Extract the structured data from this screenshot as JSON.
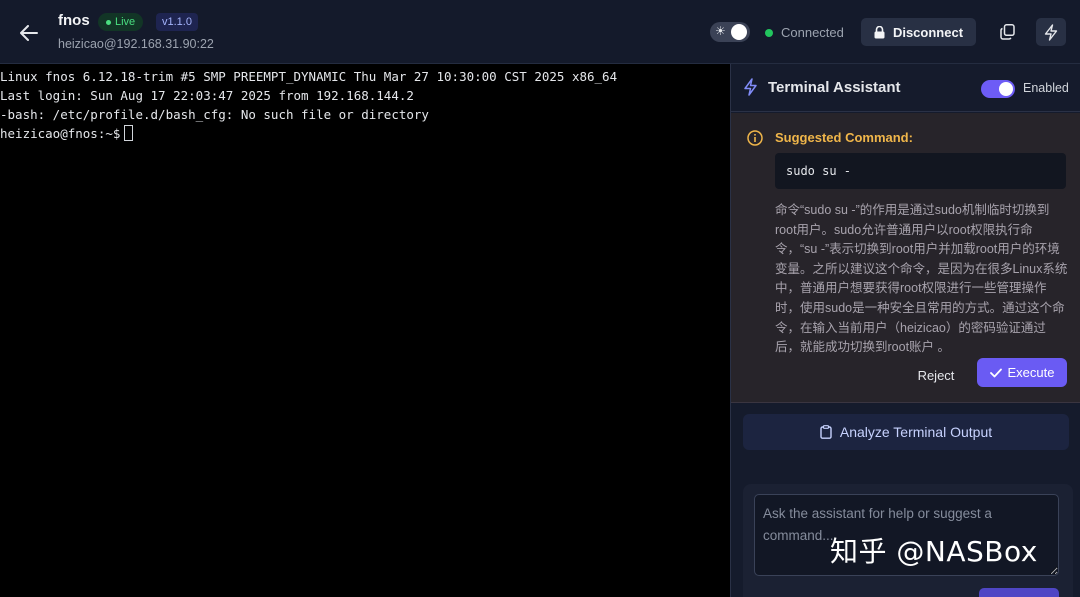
{
  "header": {
    "title": "fnos",
    "live_badge": "Live",
    "version": "v1.1.0",
    "subtitle": "heizicao@192.168.31.90:22",
    "status": "Connected",
    "status_color": "#22c55e",
    "disconnect_label": "Disconnect",
    "icons": [
      "back-arrow-icon",
      "sun-icon",
      "lock-icon",
      "copy-icon",
      "bolt-icon"
    ]
  },
  "terminal": {
    "lines": [
      "Linux fnos 6.12.18-trim #5 SMP PREEMPT_DYNAMIC Thu Mar 27 10:30:00 CST 2025 x86_64",
      "Last login: Sun Aug 17 22:03:47 2025 from 192.168.144.2",
      "-bash: /etc/profile.d/bash_cfg: No such file or directory"
    ],
    "prompt": "heizicao@fnos:~$"
  },
  "assistant": {
    "title": "Terminal Assistant",
    "enabled_label": "Enabled",
    "enabled": true,
    "suggested_label": "Suggested Command:",
    "command": "sudo su -",
    "explanation": "命令“sudo su -”的作用是通过sudo机制临时切换到root用户。sudo允许普通用户以root权限执行命令，“su -”表示切换到root用户并加载root用户的环境变量。之所以建议这个命令，是因为在很多Linux系统中，普通用户想要获得root权限进行一些管理操作时，使用sudo是一种安全且常用的方式。通过这个命令，在输入当前用户（heizicao）的密码验证通过后，就能成功切换到root账户 。",
    "reject_label": "Reject",
    "execute_label": "Execute",
    "analyze_label": "Analyze Terminal Output",
    "input_placeholder": "Ask the assistant for help or suggest a command...",
    "accent_color": "#6a5bf3",
    "warning_color": "#f0b64a"
  },
  "watermark": "知乎 @NASBox"
}
